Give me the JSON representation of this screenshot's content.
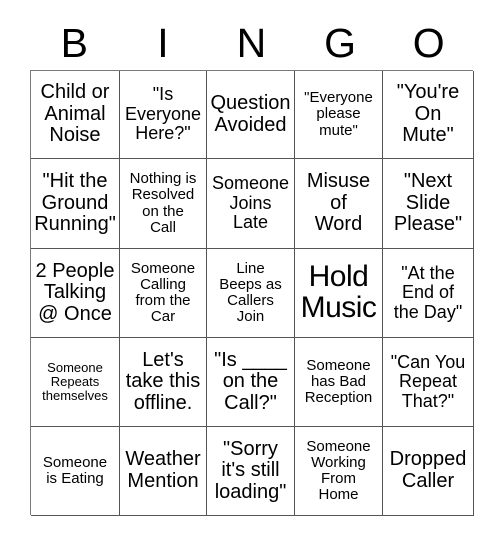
{
  "header": {
    "letters": [
      "B",
      "I",
      "N",
      "G",
      "O"
    ]
  },
  "grid": {
    "rows": [
      [
        {
          "text": "Child or\nAnimal\nNoise",
          "size": "sz-lg"
        },
        {
          "text": "\"Is\nEveryone\nHere?\"",
          "size": "sz-md"
        },
        {
          "text": "Question\nAvoided",
          "size": "sz-lg"
        },
        {
          "text": "\"Everyone\nplease\nmute\"",
          "size": "sz-sm"
        },
        {
          "text": "\"You're\nOn\nMute\"",
          "size": "sz-lg"
        }
      ],
      [
        {
          "text": "\"Hit the\nGround\nRunning\"",
          "size": "sz-lg"
        },
        {
          "text": "Nothing is\nResolved\non the\nCall",
          "size": "sz-sm"
        },
        {
          "text": "Someone\nJoins\nLate",
          "size": "sz-md"
        },
        {
          "text": "Misuse\nof\nWord",
          "size": "sz-lg"
        },
        {
          "text": "\"Next\nSlide\nPlease\"",
          "size": "sz-lg"
        }
      ],
      [
        {
          "text": "2 People\nTalking\n@ Once",
          "size": "sz-lg"
        },
        {
          "text": "Someone\nCalling\nfrom the\nCar",
          "size": "sz-sm"
        },
        {
          "text": "Line\nBeeps as\nCallers\nJoin",
          "size": "sz-sm"
        },
        {
          "text": "Hold\nMusic",
          "size": "sz-xl"
        },
        {
          "text": "\"At the\nEnd of\nthe Day\"",
          "size": "sz-md"
        }
      ],
      [
        {
          "text": "Someone\nRepeats\nthemselves",
          "size": "sz-xs"
        },
        {
          "text": "Let's\ntake this\noffline.",
          "size": "sz-lg"
        },
        {
          "text": "\"Is ____\non the\nCall?\"",
          "size": "sz-lg"
        },
        {
          "text": "Someone\nhas Bad\nReception",
          "size": "sz-sm"
        },
        {
          "text": "\"Can You\nRepeat\nThat?\"",
          "size": "sz-md"
        }
      ],
      [
        {
          "text": "Someone\nis Eating",
          "size": "sz-sm"
        },
        {
          "text": "Weather\nMention",
          "size": "sz-lg"
        },
        {
          "text": "\"Sorry\nit's still\nloading\"",
          "size": "sz-lg"
        },
        {
          "text": "Someone\nWorking\nFrom\nHome",
          "size": "sz-sm"
        },
        {
          "text": "Dropped\nCaller",
          "size": "sz-lg"
        }
      ]
    ]
  }
}
